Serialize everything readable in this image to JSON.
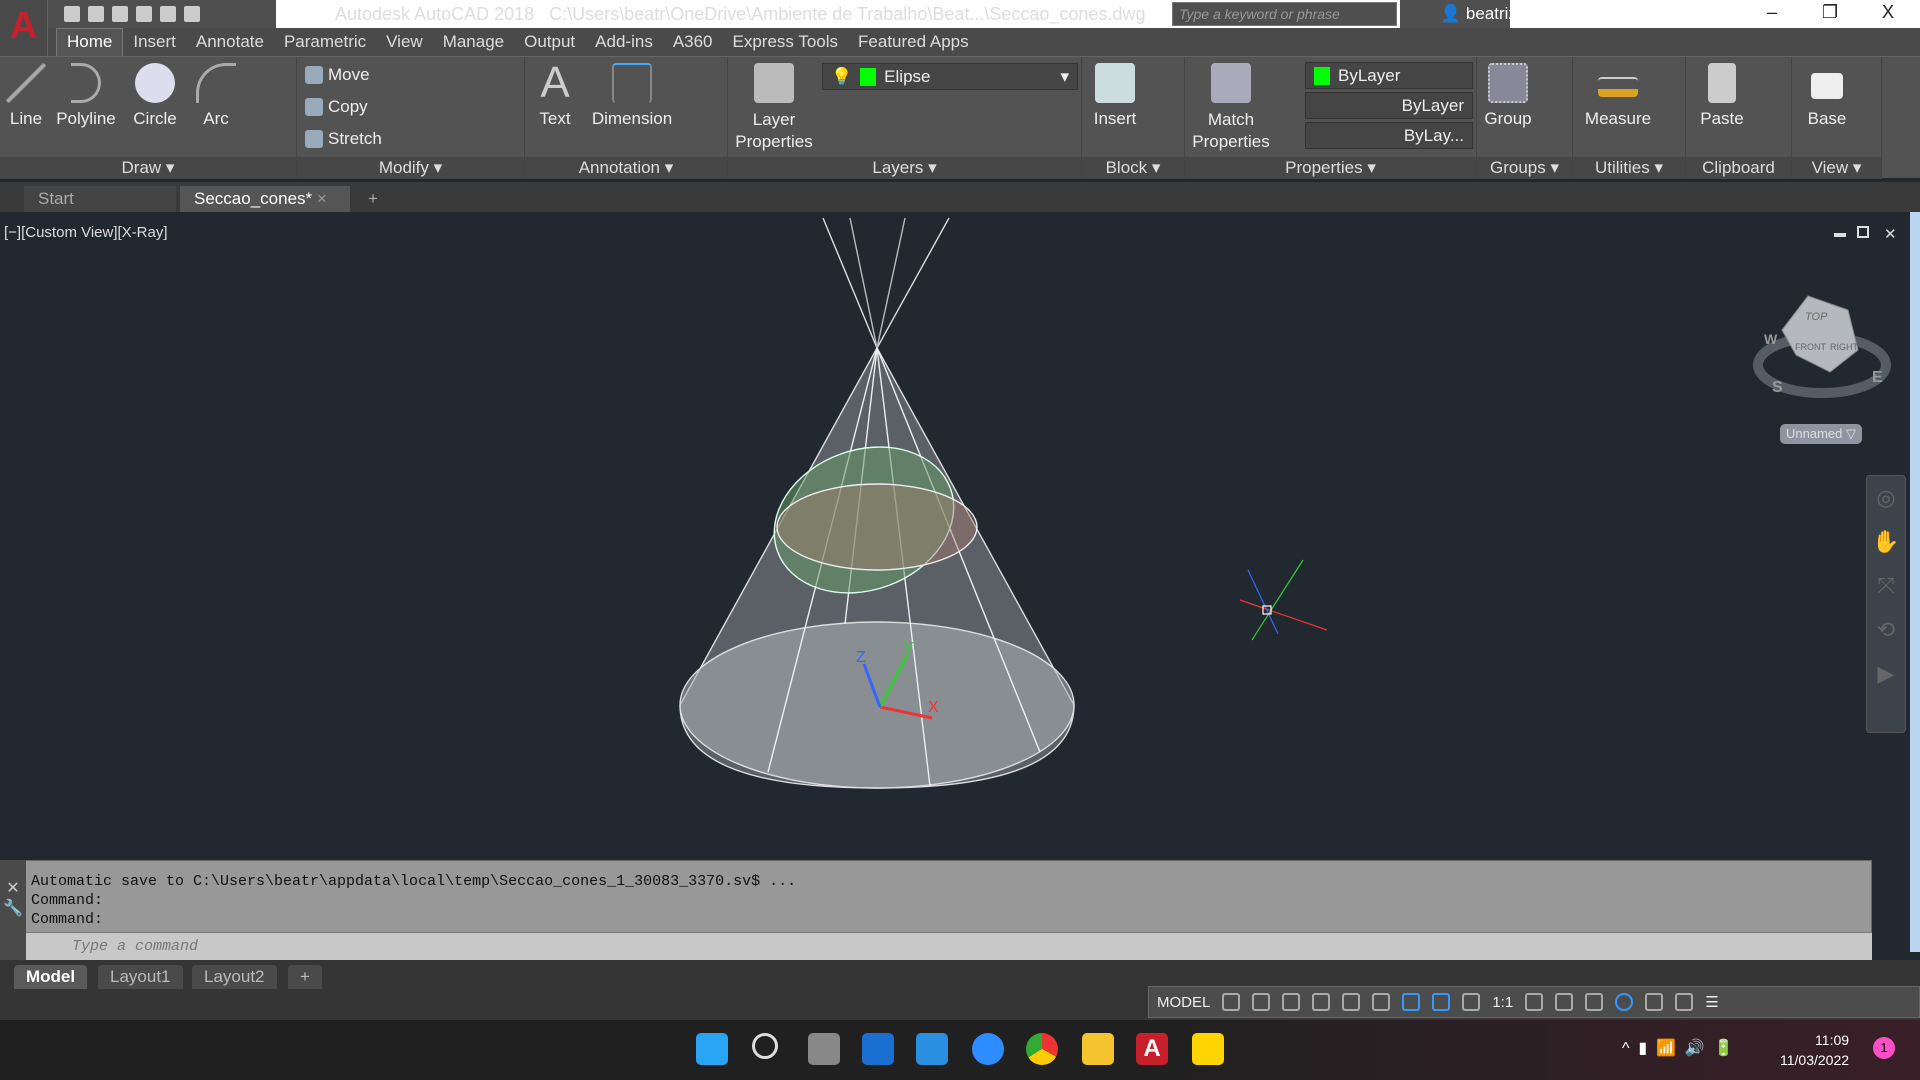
{
  "app": {
    "logo": "A",
    "title": "Autodesk AutoCAD 2018",
    "file_path": "C:\\Users\\beatr\\OneDrive\\Ambiente de Trabalho\\Beat...\\Seccao_cones.dwg",
    "search_placeholder": "Type a keyword or phrase",
    "user": "beatriz_vital...",
    "window": {
      "minimize": "–",
      "restore": "❐",
      "close": "X"
    }
  },
  "ribbon_tabs": [
    "Home",
    "Insert",
    "Annotate",
    "Parametric",
    "View",
    "Manage",
    "Output",
    "Add-ins",
    "A360",
    "Express Tools",
    "Featured Apps"
  ],
  "panels": {
    "draw": {
      "label": "Draw ▾",
      "tools": [
        "Line",
        "Polyline",
        "Circle",
        "Arc"
      ]
    },
    "modify": {
      "label": "Modify ▾",
      "tools": [
        "Move",
        "Copy",
        "Stretch"
      ]
    },
    "annotation": {
      "label": "Annotation ▾",
      "tools": [
        "Text",
        "Dimension"
      ]
    },
    "layers": {
      "label": "Layers ▾",
      "tool": "Layer Properties",
      "current_layer": "Elipse",
      "layer_color": "#00ff00"
    },
    "block": {
      "label": "Block ▾",
      "tool": "Insert"
    },
    "properties": {
      "label": "Properties ▾",
      "tool": "Match Properties",
      "color": "ByLayer",
      "linetype": "ByLayer",
      "lineweight": "ByLay..."
    },
    "groups": {
      "label": "Groups ▾",
      "tool": "Group"
    },
    "utilities": {
      "label": "Utilities ▾",
      "tool": "Measure"
    },
    "clipboard": {
      "label": "Clipboard",
      "tool": "Paste"
    },
    "view": {
      "label": "View ▾",
      "tool": "Base"
    }
  },
  "file_tabs": [
    "Start",
    "Seccao_cones*",
    "+"
  ],
  "viewport": {
    "label": "[−][Custom View][X-Ray]",
    "viewcube": {
      "top": "TOP",
      "front": "FRONT",
      "right": "RIGHT",
      "compass": [
        "W",
        "S",
        "E"
      ]
    },
    "named_view": "Unnamed ▽",
    "ucs": {
      "x": "X",
      "y": "Y",
      "z": "Z"
    }
  },
  "command": {
    "history": [
      "Automatic save to C:\\Users\\beatr\\appdata\\local\\temp\\Seccao_cones_1_30083_3370.sv$ ...",
      "Command:",
      "Command:"
    ],
    "placeholder": "Type a command"
  },
  "layout_tabs": [
    "Model",
    "Layout1",
    "Layout2",
    "+"
  ],
  "status": {
    "mode": "MODEL",
    "scale": "1:1"
  },
  "taskbar": {
    "time": "11:09",
    "date": "11/03/2022",
    "notifications": "1"
  }
}
